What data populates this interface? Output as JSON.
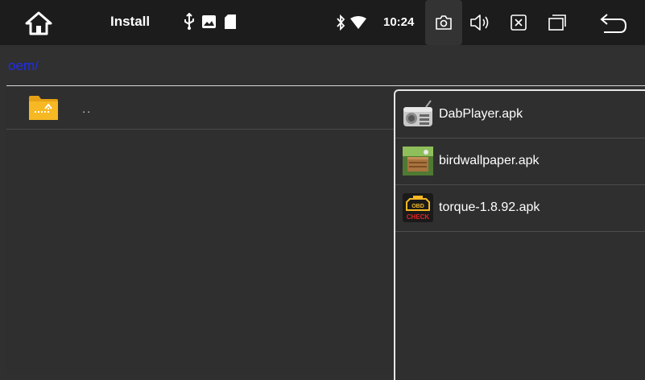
{
  "status_bar": {
    "title": "Install",
    "time": "10:24",
    "icons": [
      "home-icon",
      "usb-icon",
      "image-icon",
      "sd-card-icon",
      "bluetooth-icon",
      "wifi-icon",
      "camera-icon",
      "volume-icon",
      "close-icon",
      "recent-apps-icon",
      "back-icon"
    ]
  },
  "path": "oem/",
  "file_list": {
    "parent_label": ".."
  },
  "apk_list": [
    {
      "name": "DabPlayer.apk",
      "icon": "radio-icon"
    },
    {
      "name": "birdwallpaper.apk",
      "icon": "birdwallpaper-icon"
    },
    {
      "name": "torque-1.8.92.apk",
      "icon": "obd-check-icon"
    }
  ],
  "colors": {
    "status_bar_bg": "#1c1c1c",
    "content_bg": "#303030",
    "path_text": "#1e2cf0",
    "folder": "#f6b823"
  }
}
